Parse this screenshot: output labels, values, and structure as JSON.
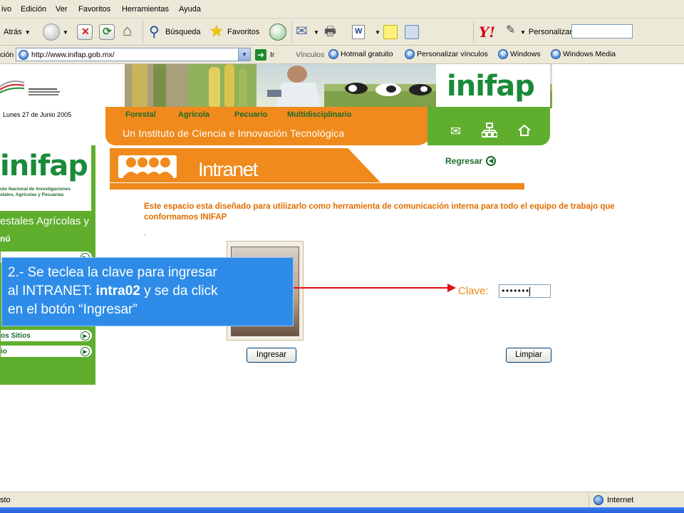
{
  "browser": {
    "menu": [
      "ivo",
      "Edición",
      "Ver",
      "Favoritos",
      "Herramientas",
      "Ayuda"
    ],
    "toolbar": {
      "back_label": "Atrás",
      "search_label": "Búsqueda",
      "favorites_label": "Favoritos",
      "yahoo_logo": "Y!",
      "personalize_label": "Personalizar"
    },
    "address": {
      "label": "ción",
      "url": "http://www.inifap.gob.mx/",
      "go_label": "Ir",
      "links_label": "Vínculos",
      "links": [
        "Hotmail gratuito",
        "Personalizar vínculos",
        "Windows",
        "Windows Media"
      ]
    },
    "status": {
      "left_text": "sto",
      "zone": "Internet"
    }
  },
  "page": {
    "date": "Lunes 27 de Junio 2005",
    "nav_tabs": [
      "Forestal",
      "Agrícola",
      "Pecuario",
      "Multidisciplinario"
    ],
    "subtitle": "Un Instituto de Ciencia e Innovación Tecnológica",
    "logo_text": "inifap",
    "institute_name_line1": "uto Nacional de Investigaciones",
    "institute_name_line2": "stales, Agrícolas y Pecuarias",
    "sectors_text": "estales Agrícolas y",
    "menu_label": "nú",
    "menu_items": [
      "os Sitios",
      "io"
    ],
    "section_title": "Intranet",
    "back_link": "Regresar",
    "intro_text": "Este espacio esta diseñado para utilizarlo como herramienta de comunicación interna para todo el equipo de trabajo que conformamos INIFAP",
    "dot": ".",
    "clave_label": "Clave:",
    "clave_value": "•••••••",
    "ingresar_label": "Ingresar",
    "limpiar_label": "Limpiar"
  },
  "callout": {
    "line1": "2.- Se teclea la clave para ingresar",
    "line2_prefix": "al INTRANET: ",
    "line2_bold": "intra02",
    "line2_suffix": " y se da click",
    "line3": "en el botón “Ingresar”"
  },
  "colors": {
    "orange": "#f08a1c",
    "green": "#5fae2e",
    "dark_green": "#1c6b2a",
    "callout_blue": "#2e8ce8",
    "arrow_red": "#e01010"
  }
}
